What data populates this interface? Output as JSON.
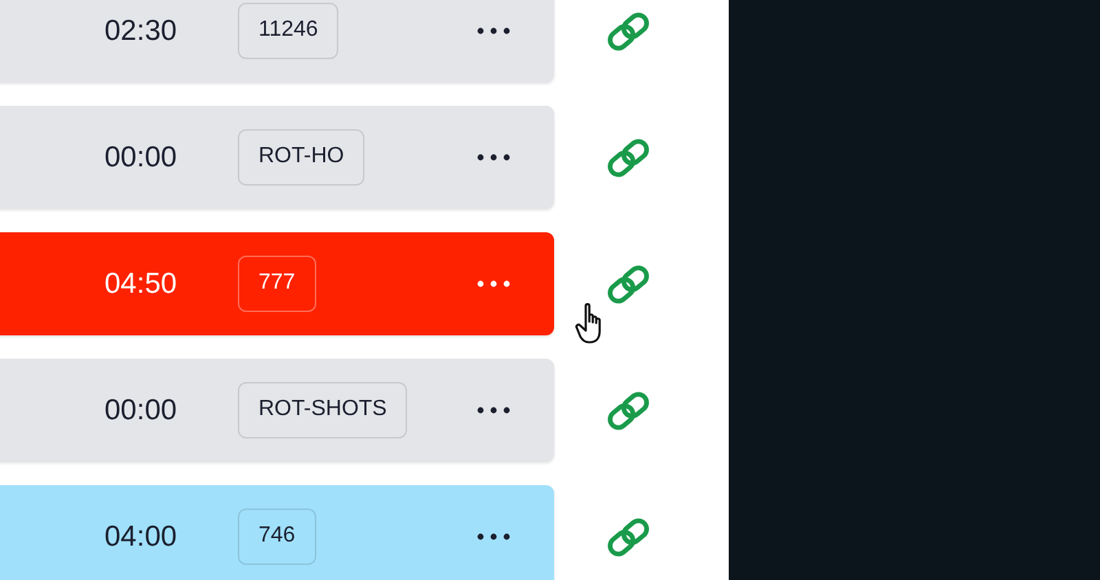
{
  "rows": [
    {
      "time": "02:30",
      "tag": "11246",
      "color": "#e4e5e9",
      "hovered": false
    },
    {
      "time": "00:00",
      "tag": "ROT-HO",
      "color": "#e4e5e9",
      "hovered": false
    },
    {
      "time": "04:50",
      "tag": "777",
      "color": "#ff2200",
      "hovered": true
    },
    {
      "time": "00:00",
      "tag": "ROT-SHOTS",
      "color": "#e4e5e9",
      "hovered": false
    },
    {
      "time": "04:00",
      "tag": "746",
      "color": "#a0e0fa",
      "hovered": false
    }
  ]
}
